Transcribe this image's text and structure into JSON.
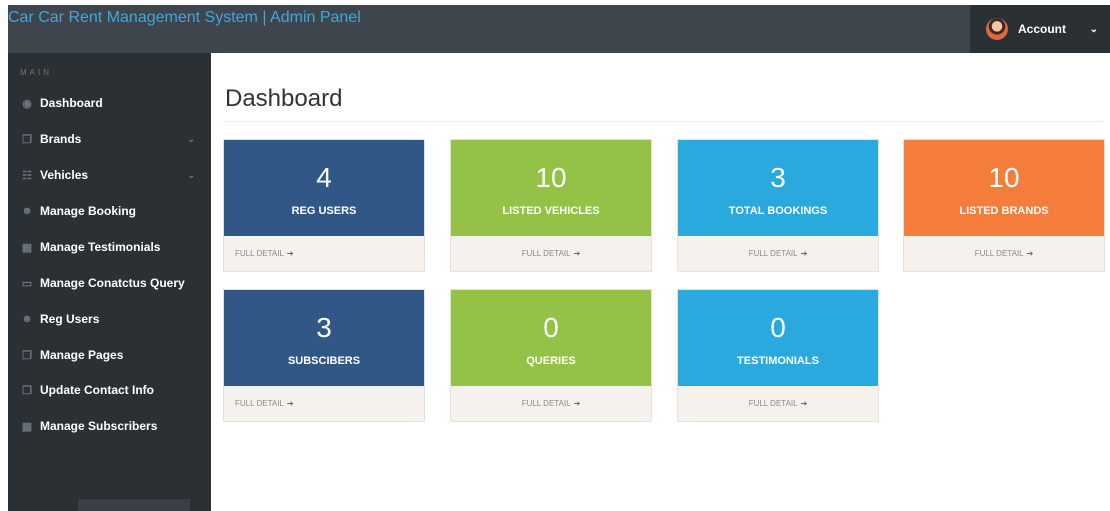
{
  "header": {
    "title": "Car Car Rent Management System | Admin Panel",
    "account_label": "Account"
  },
  "sidebar": {
    "heading": "MAIN",
    "items": [
      {
        "label": "Dashboard",
        "icon": "dashboard-icon",
        "caret": ""
      },
      {
        "label": "Brands",
        "icon": "files-icon",
        "caret": "⌄"
      },
      {
        "label": "Vehicles",
        "icon": "sitemap-icon",
        "caret": "⌄"
      },
      {
        "label": "Manage Booking",
        "icon": "users-icon",
        "caret": ""
      },
      {
        "label": "Manage Testimonials",
        "icon": "table-icon",
        "caret": ""
      },
      {
        "label": "Manage Conatctus Query",
        "icon": "desktop-icon",
        "caret": ""
      },
      {
        "label": "Reg Users",
        "icon": "users-icon",
        "caret": ""
      },
      {
        "label": "Manage Pages",
        "icon": "files-icon",
        "caret": ""
      },
      {
        "label": "Update Contact Info",
        "icon": "files-icon",
        "caret": ""
      },
      {
        "label": "Manage Subscribers",
        "icon": "table-icon",
        "caret": ""
      }
    ]
  },
  "main": {
    "title": "Dashboard",
    "detail_label": "FULL DETAIL",
    "cards": [
      {
        "value": "4",
        "label": "REG USERS",
        "color": "#305785"
      },
      {
        "value": "10",
        "label": "LISTED VEHICLES",
        "color": "#93c247"
      },
      {
        "value": "3",
        "label": "TOTAL BOOKINGS",
        "color": "#29a9de"
      },
      {
        "value": "10",
        "label": "LISTED BRANDS",
        "color": "#f57d3b"
      },
      {
        "value": "3",
        "label": "SUBSCIBERS",
        "color": "#305785"
      },
      {
        "value": "0",
        "label": "QUERIES",
        "color": "#93c247"
      },
      {
        "value": "0",
        "label": "TESTIMONIALS",
        "color": "#29a9de"
      }
    ]
  }
}
